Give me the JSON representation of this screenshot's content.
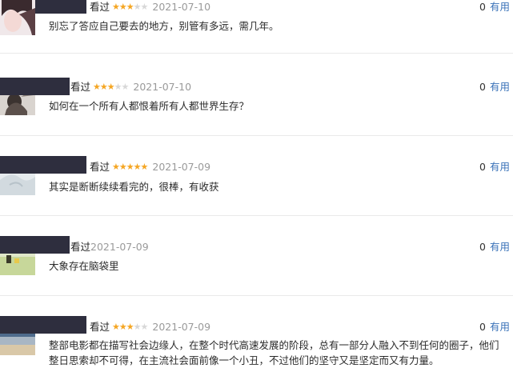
{
  "useful_label": "有用",
  "reviews": [
    {
      "status": "看过",
      "rating": 3,
      "date": "2021-07-10",
      "useful_count": "0",
      "content": "别忘了答应自己要去的地方，别管有多远，需几年。"
    },
    {
      "status": "看过",
      "rating": 3,
      "date": "2021-07-10",
      "useful_count": "0",
      "content": "如何在一个所有人都恨着所有人都世界生存？"
    },
    {
      "status": "看过",
      "rating": 5,
      "date": "2021-07-09",
      "useful_count": "0",
      "content": "其实是断断续续看完的，很棒，有收获"
    },
    {
      "status": "看过",
      "rating": null,
      "date": "2021-07-09",
      "useful_count": "0",
      "content": "大象存在脑袋里"
    },
    {
      "status": "看过",
      "rating": 3,
      "date": "2021-07-09",
      "useful_count": "0",
      "content": "整部电影都在描写社会边缘人，在整个时代高速发展的阶段，总有一部分人融入不到任何的圈子，他们整日思索却不可得，在主流社会面前像一个小丑，不过他们的坚守又是坚定而又有力量。"
    }
  ]
}
